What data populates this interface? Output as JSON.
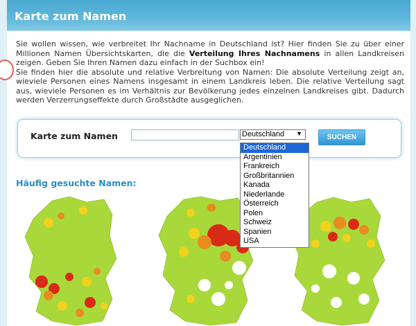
{
  "title": "Karte zum Namen",
  "intro": {
    "p1_a": "Sie wollen wissen, wie verbreitet Ihr Nachname in Deutschland ist? Hier finden Sie zu über einer Millionen Namen Übersichtskarten, die die ",
    "p1_bold": "Verteilung Ihres Nachnamens",
    "p1_b": " in allen Landkreisen zeigen. Geben Sie Ihren Namen dazu einfach in der Suchbox ein!",
    "p2": "Sie finden hier die absolute und relative Verbreitung von Namen: Die absolute Verteilung zeigt an, wieviele Personen eines Namens insgesamt in einem Landkreis leben. Die relative Verteilung sagt aus, wieviele Personen es im Verhältnis zur Bevölkerung jedes einzelnen Landkreises gibt. Dadurch werden Verzerrungseffekte durch Großstädte ausgeglichen."
  },
  "search": {
    "label": "Karte zum Namen",
    "input_value": "",
    "selected_country": "Deutschland",
    "button_label": "SUCHEN"
  },
  "dropdown": {
    "options": [
      "Deutschland",
      "Argentinien",
      "Frankreich",
      "Großbritannien",
      "Kanada",
      "Niederlande",
      "Österreich",
      "Polen",
      "Schweiz",
      "Spanien",
      "USA"
    ]
  },
  "popular": {
    "title": "Häufig gesuchte Namen:"
  },
  "colors": {
    "header": "#5fb7dc",
    "section_title": "#2b8ec0",
    "button": "#2f97d3",
    "selected_option": "#1e68d6",
    "map_green": "#a9d83a",
    "map_yellow": "#f2d21c",
    "map_orange": "#e88c1f",
    "map_red": "#d92a18"
  }
}
